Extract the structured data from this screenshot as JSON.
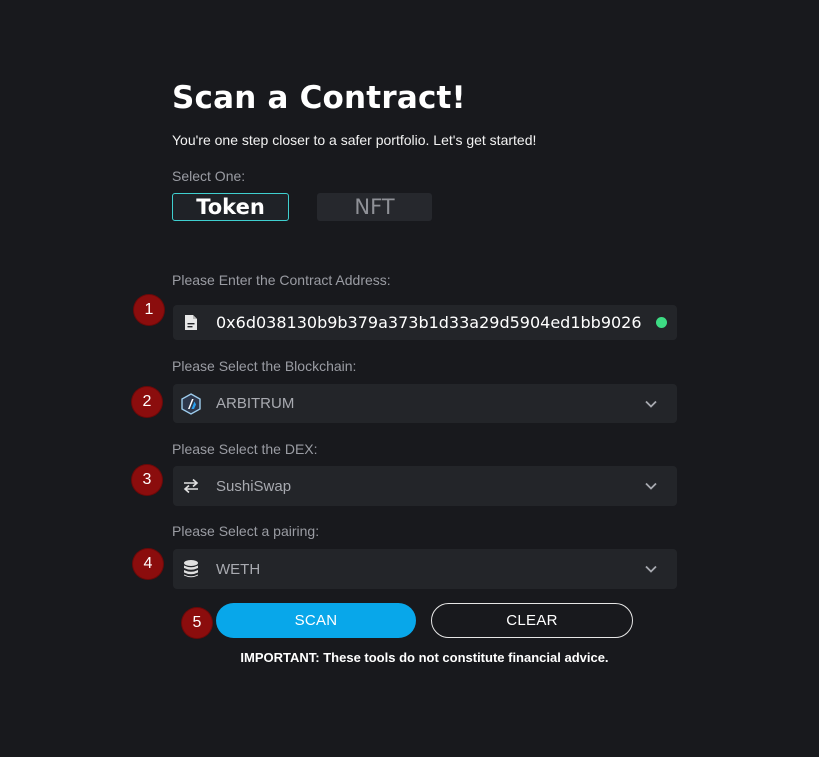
{
  "header": {
    "title": "Scan a Contract!",
    "subtitle": "You're one step closer to a safer portfolio. Let's get started!"
  },
  "type_selector": {
    "label": "Select One:",
    "options": [
      "Token",
      "NFT"
    ],
    "selected": "Token"
  },
  "address": {
    "label": "Please Enter the Contract Address:",
    "value": "0x6d038130b9b379a373b1d33a29d5904ed1bb9026",
    "icon": "document-icon",
    "valid": true
  },
  "blockchain": {
    "label": "Please Select the Blockchain:",
    "value": "ARBITRUM",
    "icon": "arbitrum-logo-icon"
  },
  "dex": {
    "label": "Please Select the DEX:",
    "value": "SushiSwap",
    "icon": "swap-arrows-icon"
  },
  "pairing": {
    "label": "Please Select a pairing:",
    "value": "WETH",
    "icon": "database-icon"
  },
  "steps": [
    "1",
    "2",
    "3",
    "4",
    "5"
  ],
  "actions": {
    "scan_label": "SCAN",
    "clear_label": "CLEAR"
  },
  "disclaimer": "IMPORTANT: These tools do not constitute financial advice.",
  "colors": {
    "background": "#18191d",
    "field": "#232529",
    "accent_outline": "#3fd0d0",
    "scan_button": "#08a7ea",
    "step_badge": "#8b0d0d",
    "valid_indicator": "#3ddc84"
  }
}
